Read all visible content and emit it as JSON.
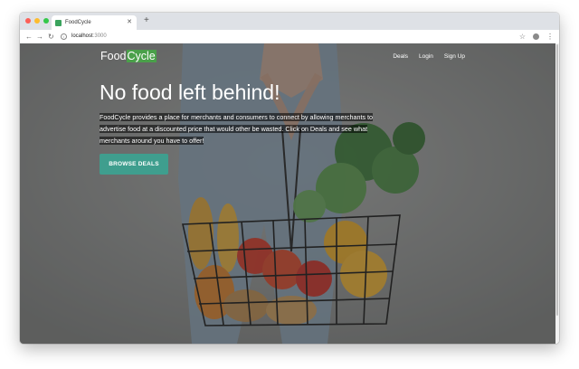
{
  "browser": {
    "tab_title": "FoodCycle",
    "tab_close_icon": "close-icon",
    "new_tab_label": "+",
    "url_host": "localhost",
    "url_port": ":3000",
    "back_icon": "←",
    "forward_icon": "→",
    "reload_icon": "↻",
    "star_icon": "☆",
    "menu_icon": "⋮",
    "traffic_colors": [
      "#fc5f57",
      "#fdbc2e",
      "#34c84a"
    ]
  },
  "site": {
    "brand_part1": "Food",
    "brand_part2": "Cycle",
    "nav": [
      "Deals",
      "Login",
      "Sign Up"
    ],
    "headline": "No food left behind!",
    "description": "FoodCycle provides a place for merchants and consumers to connect by allowing merchants to advertise food at a discounted price that would other be wasted. Click on Deals and see what merchants around you have to offer!",
    "cta_label": "BROWSE DEALS",
    "accent_green": "#4aa04a",
    "cta_color": "#3f9e8e"
  }
}
